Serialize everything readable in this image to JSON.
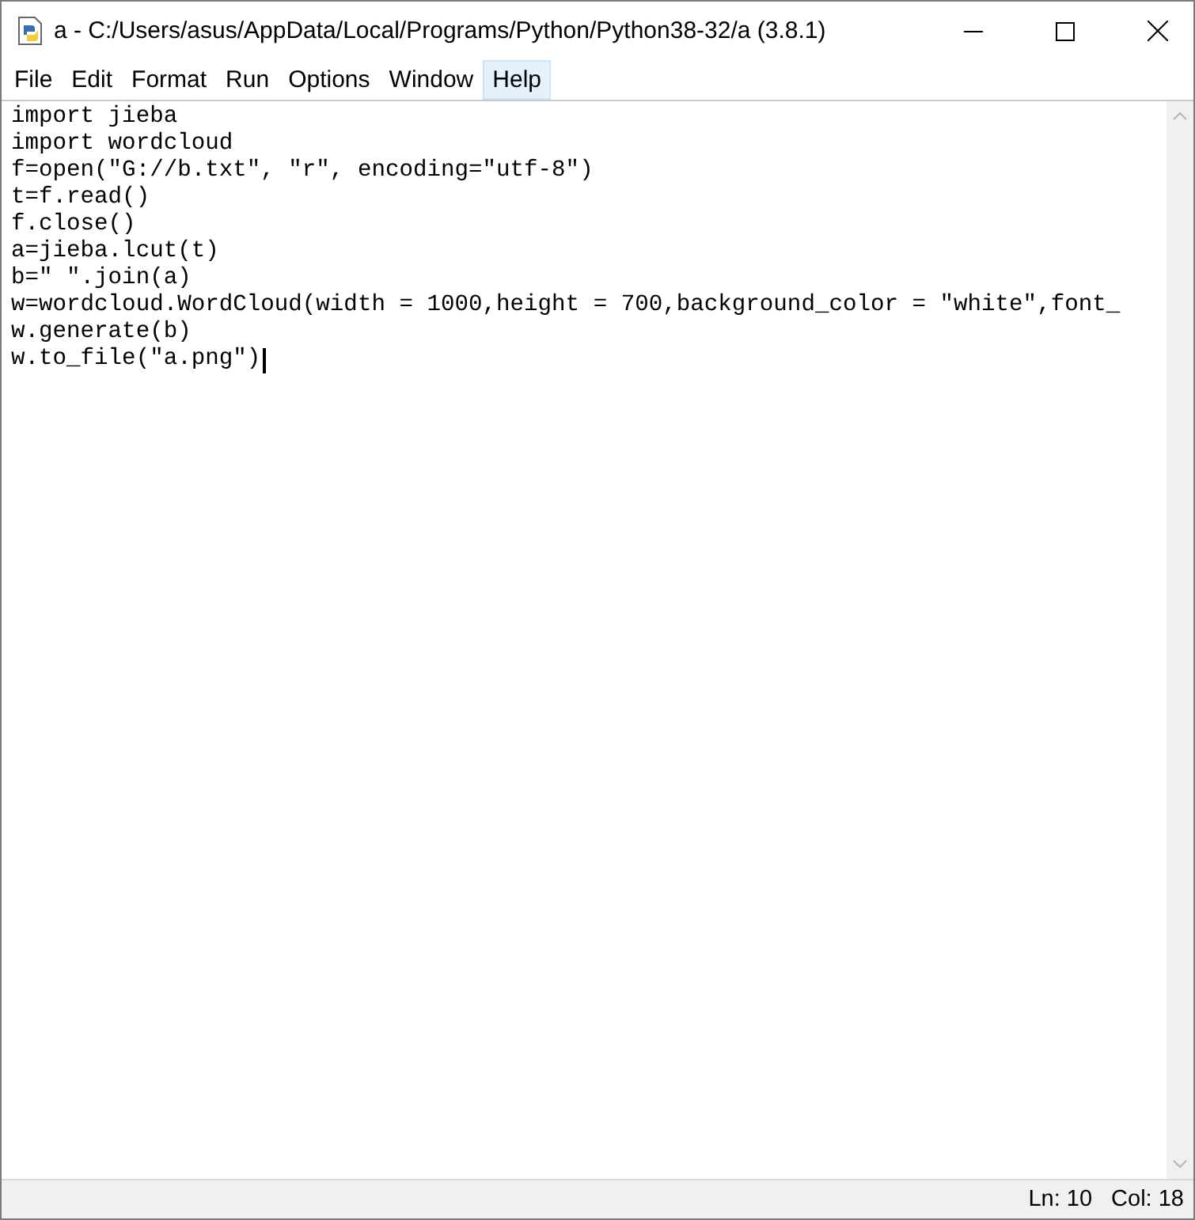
{
  "window": {
    "title": "a - C:/Users/asus/AppData/Local/Programs/Python/Python38-32/a (3.8.1)"
  },
  "menu": [
    {
      "label": "File",
      "selected": false
    },
    {
      "label": "Edit",
      "selected": false
    },
    {
      "label": "Format",
      "selected": false
    },
    {
      "label": "Run",
      "selected": false
    },
    {
      "label": "Options",
      "selected": false
    },
    {
      "label": "Window",
      "selected": false
    },
    {
      "label": "Help",
      "selected": true
    }
  ],
  "editor": {
    "lines": [
      "import jieba",
      "import wordcloud",
      "f=open(\"G://b.txt\", \"r\", encoding=\"utf-8\")",
      "t=f.read()",
      "f.close()",
      "a=jieba.lcut(t)",
      "b=\" \".join(a)",
      "w=wordcloud.WordCloud(width = 1000,height = 700,background_color = \"white\",font_",
      "w.generate(b)",
      "w.to_file(\"a.png\")"
    ]
  },
  "status_bar": {
    "line": "Ln: 10",
    "column": "Col: 18"
  }
}
